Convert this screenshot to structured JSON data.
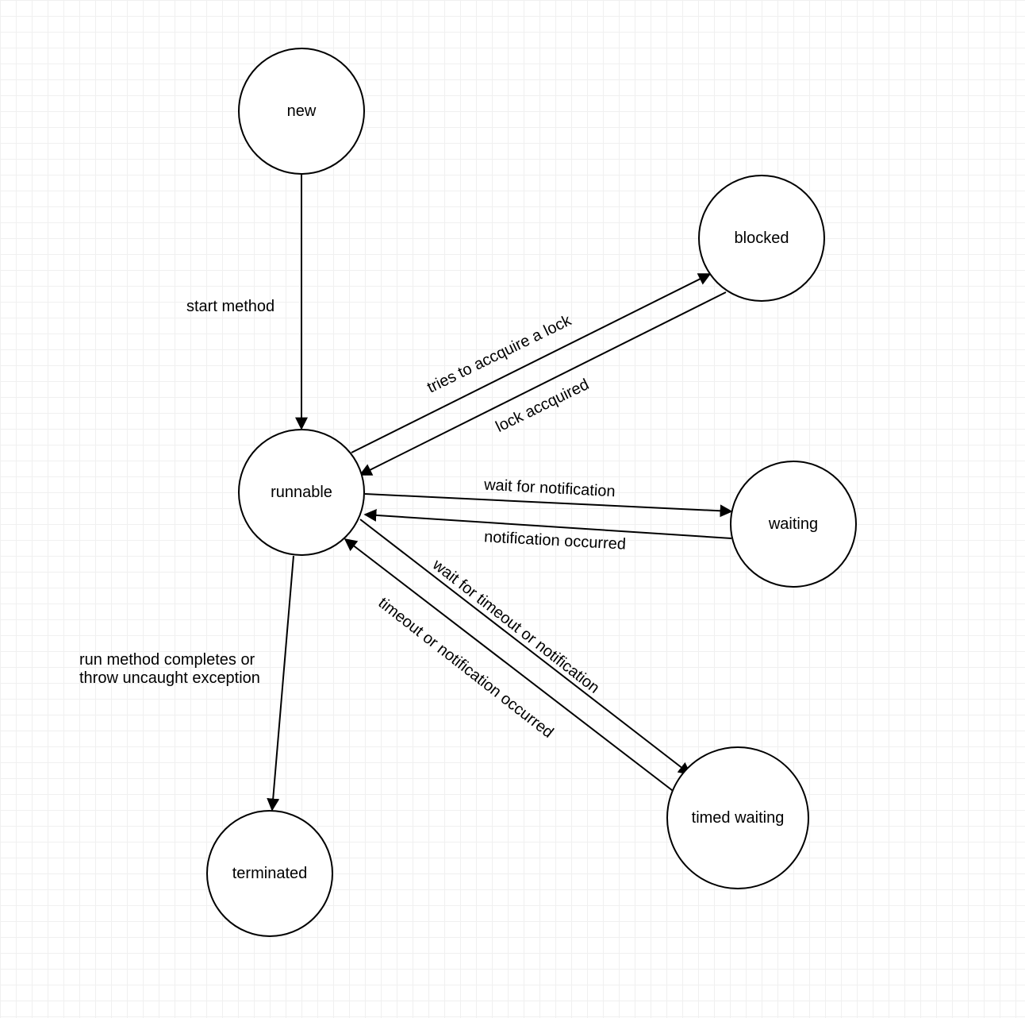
{
  "nodes": {
    "new": {
      "label": "new"
    },
    "runnable": {
      "label": "runnable"
    },
    "blocked": {
      "label": "blocked"
    },
    "waiting": {
      "label": "waiting"
    },
    "timed_waiting": {
      "label": "timed waiting"
    },
    "terminated": {
      "label": "terminated"
    }
  },
  "edges": {
    "new_to_runnable": {
      "label": "start method"
    },
    "runnable_to_blocked": {
      "label": "tries to accquire a lock"
    },
    "blocked_to_runnable": {
      "label": "lock accquired"
    },
    "runnable_to_waiting": {
      "label": "wait for notification"
    },
    "waiting_to_runnable": {
      "label": "notification occurred"
    },
    "runnable_to_timed": {
      "label": "wait for timeout or notification"
    },
    "timed_to_runnable": {
      "label": "timeout or notification occurred"
    },
    "runnable_to_terminated": {
      "label": "run method completes or throw uncaught exception"
    }
  }
}
